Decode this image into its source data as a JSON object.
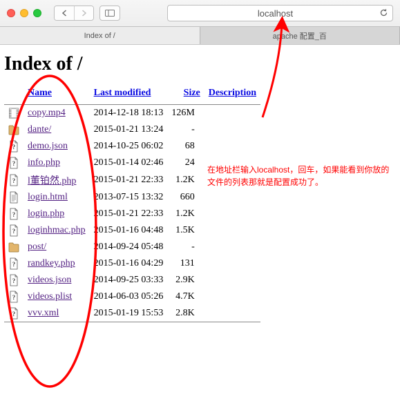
{
  "url_bar": {
    "url": "localhost"
  },
  "tabs": [
    {
      "label": "Index of /"
    },
    {
      "label": "apache 配置_百"
    }
  ],
  "page": {
    "title": "Index of /",
    "headers": {
      "name": "Name",
      "modified": "Last modified",
      "size": "Size",
      "description": "Description"
    },
    "files": [
      {
        "icon": "video",
        "name": "copy.mp4",
        "date": "2014-12-18 18:13",
        "size": "126M"
      },
      {
        "icon": "folder",
        "name": "dante/",
        "date": "2015-01-21 13:24",
        "size": "-"
      },
      {
        "icon": "unknown",
        "name": "demo.json",
        "date": "2014-10-25 06:02",
        "size": "68"
      },
      {
        "icon": "unknown",
        "name": "info.php",
        "date": "2015-01-14 02:46",
        "size": "24"
      },
      {
        "icon": "unknown",
        "name": "l董铂然.php",
        "date": "2015-01-21 22:33",
        "size": "1.2K"
      },
      {
        "icon": "text",
        "name": "login.html",
        "date": "2013-07-15 13:32",
        "size": "660"
      },
      {
        "icon": "unknown",
        "name": "login.php",
        "date": "2015-01-21 22:33",
        "size": "1.2K"
      },
      {
        "icon": "unknown",
        "name": "loginhmac.php",
        "date": "2015-01-16 04:48",
        "size": "1.5K"
      },
      {
        "icon": "folder",
        "name": "post/",
        "date": "2014-09-24 05:48",
        "size": "-"
      },
      {
        "icon": "unknown",
        "name": "randkey.php",
        "date": "2015-01-16 04:29",
        "size": "131"
      },
      {
        "icon": "unknown",
        "name": "videos.json",
        "date": "2014-09-25 03:33",
        "size": "2.9K"
      },
      {
        "icon": "unknown",
        "name": "videos.plist",
        "date": "2014-06-03 05:26",
        "size": "4.7K"
      },
      {
        "icon": "unknown",
        "name": "vvv.xml",
        "date": "2015-01-19 15:53",
        "size": "2.8K"
      }
    ]
  },
  "annotation": {
    "text": "在地址栏输入localhost，回车，如果能看到你放的文件的列表那就是配置成功了。"
  }
}
